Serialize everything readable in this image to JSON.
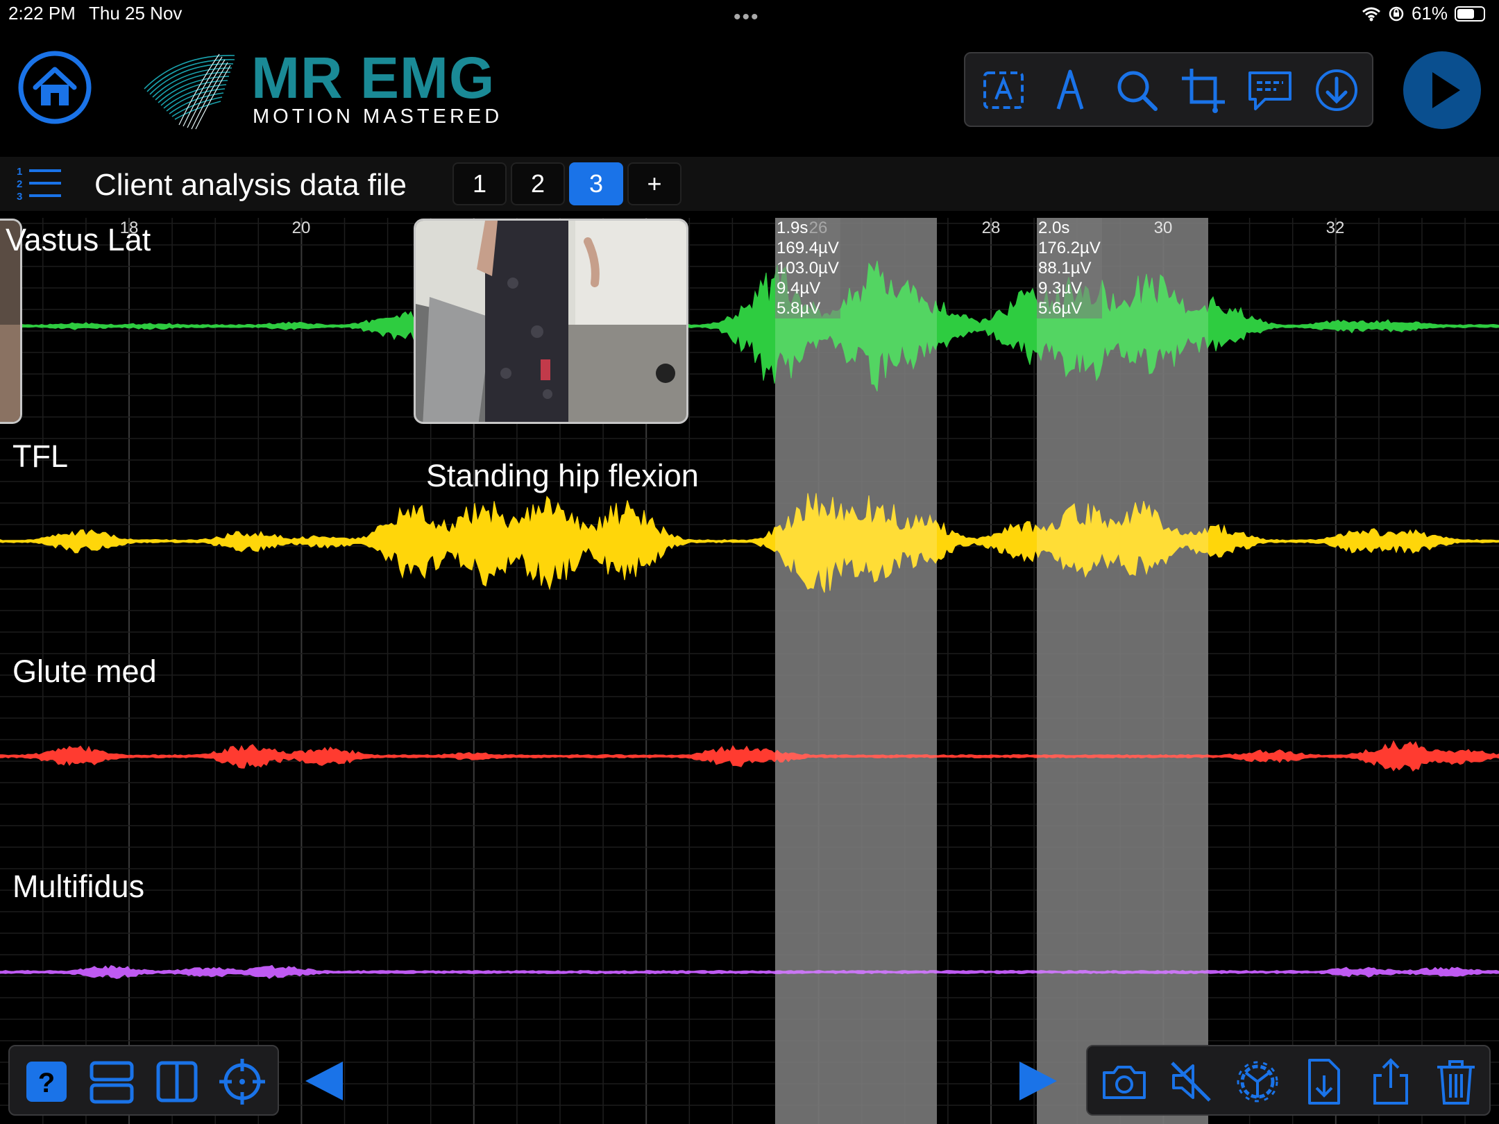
{
  "status_bar": {
    "time": "2:22 PM",
    "date": "Thu 25 Nov",
    "dots": "•••",
    "battery": "61%"
  },
  "header": {
    "logo_title": "MR EMG",
    "logo_subtitle": "MOTION MASTERED"
  },
  "toolbar_top": {
    "icons": [
      "text-box-icon",
      "pen-icon",
      "search-icon",
      "crop-icon",
      "comment-icon",
      "download-icon"
    ]
  },
  "subheader": {
    "file_title": "Client analysis data file",
    "tabs": [
      "1",
      "2",
      "3",
      "+"
    ],
    "active_tab": "3"
  },
  "chart_data": {
    "type": "line",
    "x_ticks": [
      "18",
      "20",
      "26",
      "28",
      "30",
      "32"
    ],
    "channels": [
      {
        "name": "Vastus Lat",
        "color": "#2ecc40"
      },
      {
        "name": "TFL",
        "color": "#ffd60a"
      },
      {
        "name": "Glute med",
        "color": "#ff3b30"
      },
      {
        "name": "Multifidus",
        "color": "#bf5af2"
      }
    ],
    "annotation": "Standing hip flexion",
    "selections": [
      {
        "duration": "1.9s",
        "values": [
          "169.4µV",
          "103.0µV",
          "9.4µV",
          "5.8µV"
        ]
      },
      {
        "duration": "2.0s",
        "values": [
          "176.2µV",
          "88.1µV",
          "9.3µV",
          "5.6µV"
        ]
      }
    ]
  },
  "colors": {
    "accent": "#1a73e8",
    "logo": "#1a8a96",
    "panel": "#1c1c1e"
  },
  "toolbar_bottom_left": {
    "icons": [
      "help-icon",
      "rows-layout-icon",
      "columns-layout-icon",
      "crosshair-icon"
    ]
  },
  "toolbar_bottom_right": {
    "icons": [
      "camera-icon",
      "mute-icon",
      "settings-icon",
      "import-file-icon",
      "share-icon",
      "trash-icon"
    ]
  }
}
